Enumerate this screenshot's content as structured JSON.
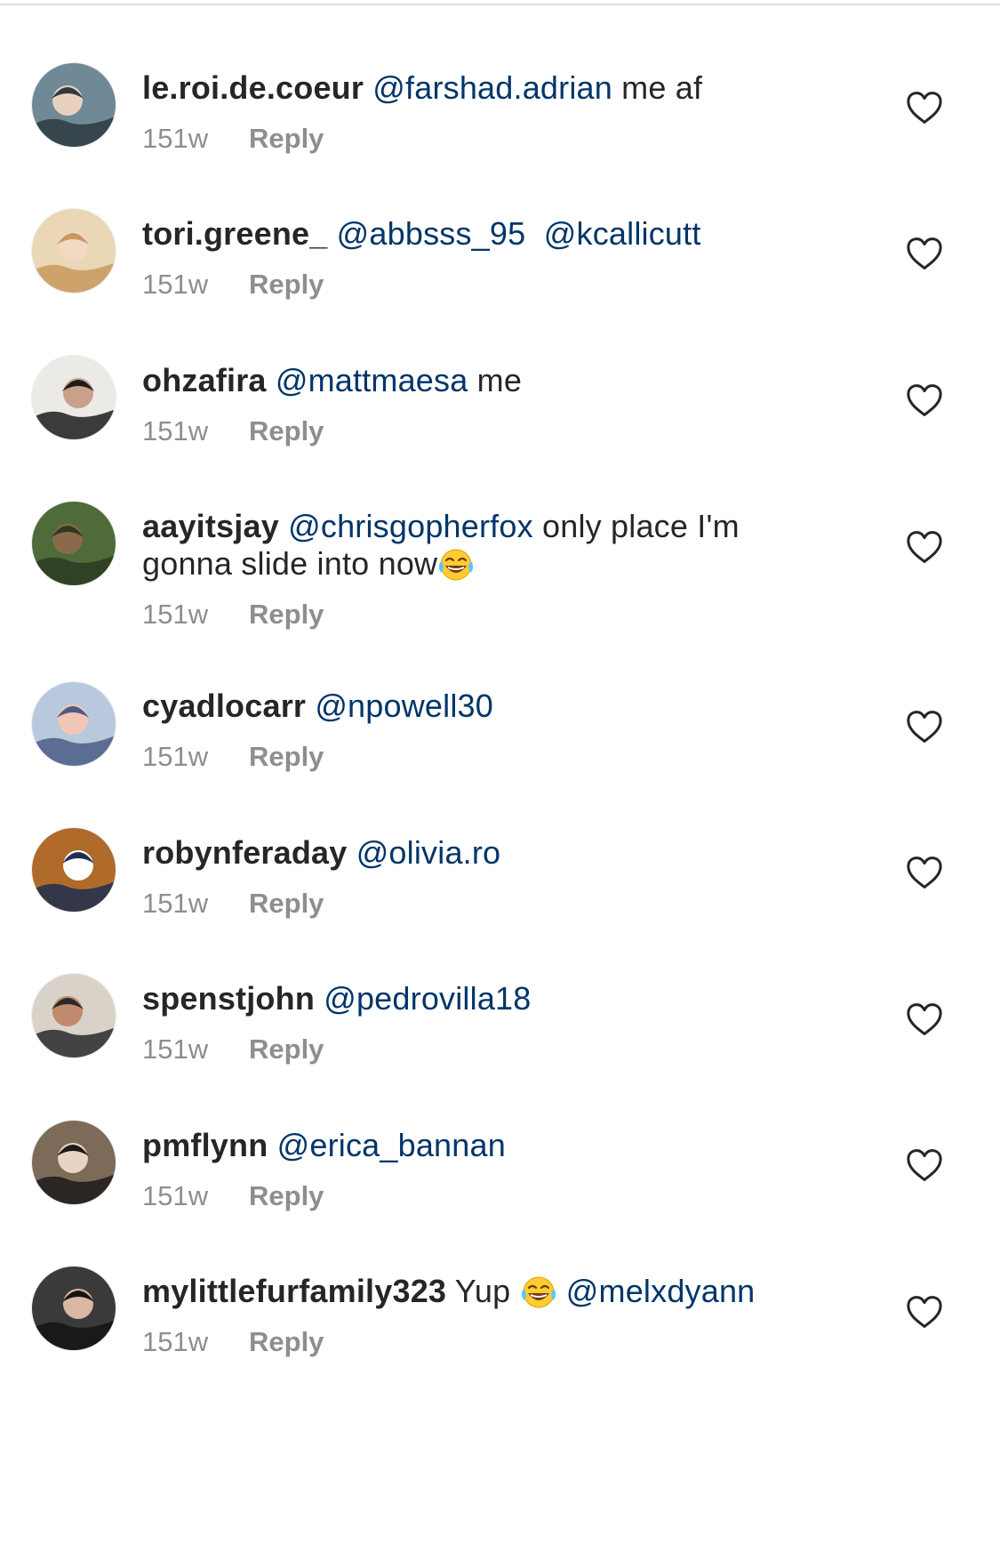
{
  "comments": [
    {
      "username": "le.roi.de.coeur",
      "parts": [
        {
          "type": "mention",
          "text": "@farshad.adrian"
        },
        {
          "type": "text",
          "text": " me af"
        }
      ],
      "time": "151w",
      "reply": "Reply",
      "avatar_colors": [
        "#6f8a96",
        "#2d3a40",
        "#e8d2bf"
      ]
    },
    {
      "username": "tori.greene_",
      "parts": [
        {
          "type": "mention",
          "text": "@abbsss_95"
        },
        {
          "type": "text",
          "text": "  "
        },
        {
          "type": "mention",
          "text": "@kcallicutt"
        }
      ],
      "time": "151w",
      "reply": "Reply",
      "avatar_colors": [
        "#e9d7b6",
        "#c99a5e",
        "#f2d9c4"
      ]
    },
    {
      "username": "ohzafira",
      "parts": [
        {
          "type": "mention",
          "text": "@mattmaesa"
        },
        {
          "type": "text",
          "text": " me"
        }
      ],
      "time": "151w",
      "reply": "Reply",
      "avatar_colors": [
        "#eceae6",
        "#1e1b1b",
        "#caa08b"
      ]
    },
    {
      "username": "aayitsjay",
      "parts": [
        {
          "type": "mention",
          "text": "@chrisgopherfox"
        },
        {
          "type": "text",
          "text": " only place I'm gonna slide into now"
        },
        {
          "type": "emoji",
          "text": "laughing-emoji"
        }
      ],
      "time": "151w",
      "reply": "Reply",
      "avatar_colors": [
        "#4f6b3a",
        "#2c3a22",
        "#8a6a4a"
      ]
    },
    {
      "username": "cyadlocarr",
      "parts": [
        {
          "type": "mention",
          "text": "@npowell30"
        }
      ],
      "time": "151w",
      "reply": "Reply",
      "avatar_colors": [
        "#b9c9dd",
        "#4a5d85",
        "#f2c6b6"
      ]
    },
    {
      "username": "robynferaday",
      "parts": [
        {
          "type": "mention",
          "text": "@olivia.ro"
        }
      ],
      "time": "151w",
      "reply": "Reply",
      "avatar_colors": [
        "#b06a2a",
        "#1f2d4f",
        "#ffffff"
      ]
    },
    {
      "username": "spenstjohn",
      "parts": [
        {
          "type": "mention",
          "text": "@pedrovilla18"
        }
      ],
      "time": "151w",
      "reply": "Reply",
      "avatar_colors": [
        "#d8d2c8",
        "#2a2a2a",
        "#c08a6c"
      ]
    },
    {
      "username": "pmflynn",
      "parts": [
        {
          "type": "mention",
          "text": "@erica_bannan"
        }
      ],
      "time": "151w",
      "reply": "Reply",
      "avatar_colors": [
        "#7d6a58",
        "#1c1a18",
        "#e9d3c3"
      ]
    },
    {
      "username": "mylittlefurfamily323",
      "parts": [
        {
          "type": "text",
          "text": " Yup "
        },
        {
          "type": "emoji",
          "text": "laughing-emoji"
        },
        {
          "type": "text",
          "text": " "
        },
        {
          "type": "mention",
          "text": "@melxdyann"
        }
      ],
      "time": "151w",
      "reply": "Reply",
      "avatar_colors": [
        "#3a3a3a",
        "#141414",
        "#d9b7a4"
      ]
    }
  ],
  "colors": {
    "mention": "#003569",
    "meta": "#8e8e8e",
    "text": "#262626"
  }
}
